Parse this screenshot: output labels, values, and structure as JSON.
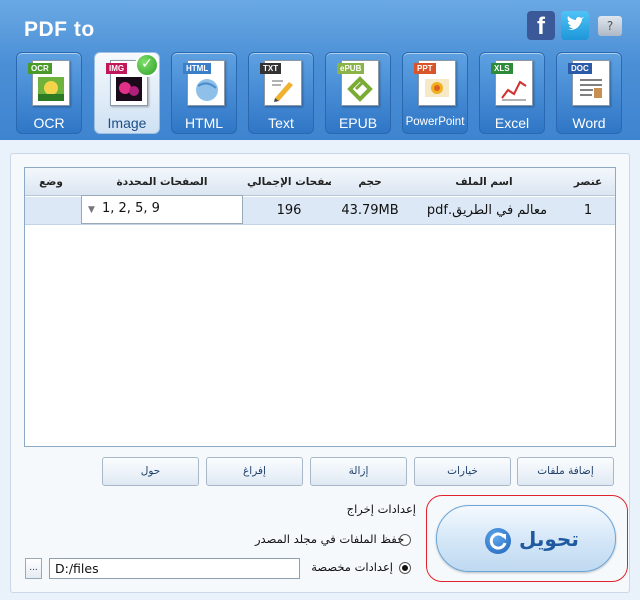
{
  "app": {
    "title": "PDF to"
  },
  "social": {
    "facebook_glyph": "f"
  },
  "toolbar": {
    "items": [
      {
        "label": "OCR",
        "tag": "OCR",
        "tag_color": "#4a9a2a"
      },
      {
        "label": "Image",
        "tag": "IMG",
        "tag_color": "#c0185a",
        "active": true
      },
      {
        "label": "HTML",
        "tag": "HTML",
        "tag_color": "#3a7fc8"
      },
      {
        "label": "Text",
        "tag": "TXT",
        "tag_color": "#333333"
      },
      {
        "label": "EPUB",
        "tag": "ePUB",
        "tag_color": "#8ab44a"
      },
      {
        "label": "PowerPoint",
        "tag": "PPT",
        "tag_color": "#d8542a"
      },
      {
        "label": "Excel",
        "tag": "XLS",
        "tag_color": "#2f8a3a"
      },
      {
        "label": "Word",
        "tag": "DOC",
        "tag_color": "#2a5aa8"
      }
    ]
  },
  "table": {
    "headers": {
      "item": "عنصر",
      "filename": "اسم الملف",
      "size": "حجم",
      "total_pages": "عدد الصفحات الإجمالي",
      "selected_pages": "الصفحات المحددة",
      "status": "وضع"
    },
    "rows": [
      {
        "item": "1",
        "filename": "معالم في الطريق.pdf",
        "size": "43.79MB",
        "total_pages": "196",
        "selected_pages": "1, 2, 5, 9",
        "status": ""
      }
    ]
  },
  "actions": {
    "add_files": "إضافة ملفات",
    "options": "خيارات",
    "remove": "إزالة",
    "clear": "إفراغ",
    "about": "حول"
  },
  "output": {
    "title": "إعدادات إخراج",
    "option_source": "حفظ الملفات في مجلد المصدر",
    "option_custom": "إعدادات مخصصة",
    "selected": "custom",
    "path": "D:/files",
    "browse_label": "..."
  },
  "convert": {
    "label": "تحويل"
  },
  "colors": {
    "header_blue": "#4b8fd6",
    "convert_text": "#1f5aa0",
    "highlight_ring": "#e0232b"
  }
}
